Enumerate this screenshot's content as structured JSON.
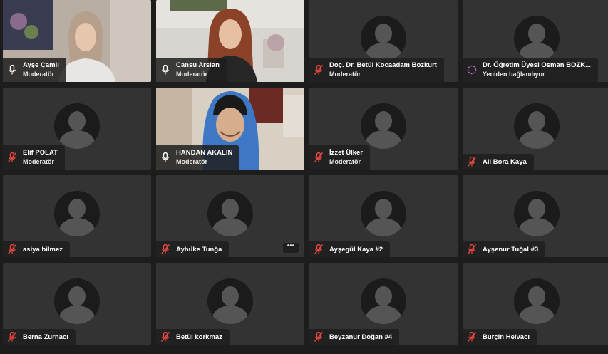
{
  "participants": [
    {
      "name": "Ayşe Çamlı",
      "role": "Moderatör"
    },
    {
      "name": "Cansu Arslan",
      "role": "Moderatör"
    },
    {
      "name": "Doç. Dr. Betül Kocaadam Bozkurt",
      "role": "Moderatör"
    },
    {
      "name": "Dr. Öğretim Üyesi Osman BOZK...",
      "role": "Yeniden bağlanılıyor"
    },
    {
      "name": "Elif POLAT",
      "role": "Moderatör"
    },
    {
      "name": "HANDAN AKALIN",
      "role": "Moderatör"
    },
    {
      "name": "İzzet Ülker",
      "role": "Moderatör"
    },
    {
      "name": "Ali Bora Kaya",
      "role": ""
    },
    {
      "name": "asiya bilmez",
      "role": ""
    },
    {
      "name": "Aybüke Tunğa",
      "role": ""
    },
    {
      "name": "Ayşegül Kaya #2",
      "role": ""
    },
    {
      "name": "Ayşenur Tuğal #3",
      "role": ""
    },
    {
      "name": "Berna Zurnacı",
      "role": ""
    },
    {
      "name": "Betül korkmaz",
      "role": ""
    },
    {
      "name": "Beyzanur Doğan #4",
      "role": ""
    },
    {
      "name": "Burçin Helvacı",
      "role": ""
    }
  ],
  "more_button_label": "•••",
  "colors": {
    "muted_mic": "#e8483d",
    "active_speaker_border": "#d0744b",
    "tile_bg": "#333333",
    "reconnecting_ring": "#c86bd8"
  }
}
